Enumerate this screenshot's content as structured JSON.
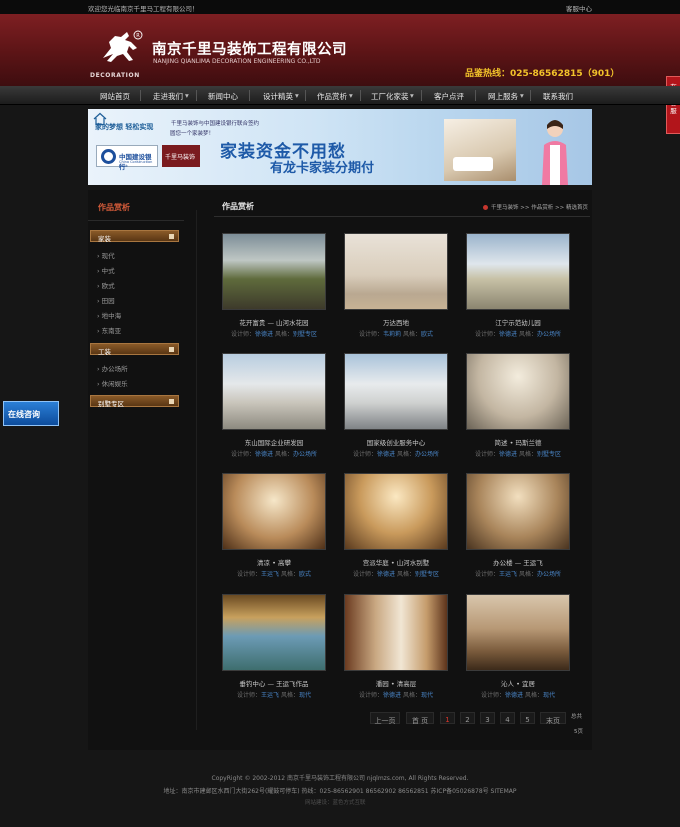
{
  "topbar": {
    "welcome": "欢迎您光临南京千里马工程有限公司！",
    "service": "客服中心"
  },
  "header": {
    "logo_en": "DECORATION",
    "company_cn": "南京千里马装饰工程有限公司",
    "company_en": "NANJING QIANLIMA DECORATION ENGINEERING CO.,LTD",
    "hotline": "品鉴热线：025-86562815（901）"
  },
  "side_tab": {
    "label": "在线客服"
  },
  "float_consult": {
    "label": "在线咨询"
  },
  "nav": {
    "items": [
      "网站首页",
      "走进我们",
      "新闻中心",
      "设计精英",
      "作品赏析",
      "工厂化家装",
      "客户点评",
      "网上服务",
      "联系我们"
    ]
  },
  "banner": {
    "slogan_a": "家的梦想 轻松实现",
    "slogan_b": "千里马装饰与中国建设银行联合签约",
    "slogan_c": "圆您一个家装梦！",
    "bank": "中国建设银行",
    "bank_en": "China Construction Bank",
    "partner": "千里马装饰",
    "headline_1": "家装资金不用愁",
    "headline_2": "有龙卡家装分期付"
  },
  "left": {
    "title": "作品赏析",
    "categories": [
      {
        "label": "家装",
        "items": [
          "现代",
          "中式",
          "欧式",
          "田园",
          "地中海",
          "东南亚"
        ]
      },
      {
        "label": "工装",
        "items": [
          "办公场所",
          "休闲娱乐"
        ]
      },
      {
        "label": "别墅专区",
        "items": []
      }
    ]
  },
  "content": {
    "title": "作品赏析",
    "breadcrumb": {
      "home": "千里马装饰",
      "sep": ">>",
      "section": "作品赏析",
      "current": "精选首页"
    }
  },
  "works": [
    {
      "name": "花开富贵 — 山河水花园",
      "designer": "徐德进",
      "style": "别墅专区"
    },
    {
      "name": "万达西地",
      "designer": "韦莉莉",
      "style": "欧式"
    },
    {
      "name": "江宁示范幼儿园",
      "designer": "徐德进",
      "style": "办公场所"
    },
    {
      "name": "东山国际企业研发园",
      "designer": "徐德进",
      "style": "办公场所"
    },
    {
      "name": "国家级创业服务中心",
      "designer": "徐德进",
      "style": "办公场所"
    },
    {
      "name": "简述 • 玛斯兰德",
      "designer": "徐德进",
      "style": "别墅专区"
    },
    {
      "name": "清凉 • 高攀",
      "designer": "王运飞",
      "style": "欧式"
    },
    {
      "name": "宫派华庭 • 山河水别墅",
      "designer": "徐德进",
      "style": "别墅专区"
    },
    {
      "name": "办公楼 — 王运飞",
      "designer": "王运飞",
      "style": "办公场所"
    },
    {
      "name": "垂钓中心 — 王运飞作品",
      "designer": "王运飞",
      "style": "现代"
    },
    {
      "name": "潘园 • 清高层",
      "designer": "徐德进",
      "style": "现代"
    },
    {
      "name": "沁人 • 宜居",
      "designer": "徐德进",
      "style": "现代"
    }
  ],
  "labels": {
    "designer": "设计师：",
    "style": "风格："
  },
  "pagination": {
    "prev": "上一页",
    "first": "首 页",
    "pages": [
      "1",
      "2",
      "3",
      "4",
      "5"
    ],
    "current": "1",
    "last": "末页",
    "total_1": "总共",
    "total_2": "5页"
  },
  "footer": {
    "copyright": "CopyRight © 2002-2012 南京千里马装饰工程有限公司 njqlmzs.com, All Rights Reserved.",
    "address": "地址：南京市建邺区水西门大街262号(耀鼓可停车)  热线：025-86562901 86562902 86562851  苏ICP备05026878号  SITEMAP",
    "design": "网站建设：蓝色方式互联"
  },
  "colors": {
    "header": "#6d1a1d",
    "hotline": "#f2c32a",
    "category_bar": "#7a4c20",
    "accent": "#d65c3a",
    "link": "#4a86c8"
  }
}
